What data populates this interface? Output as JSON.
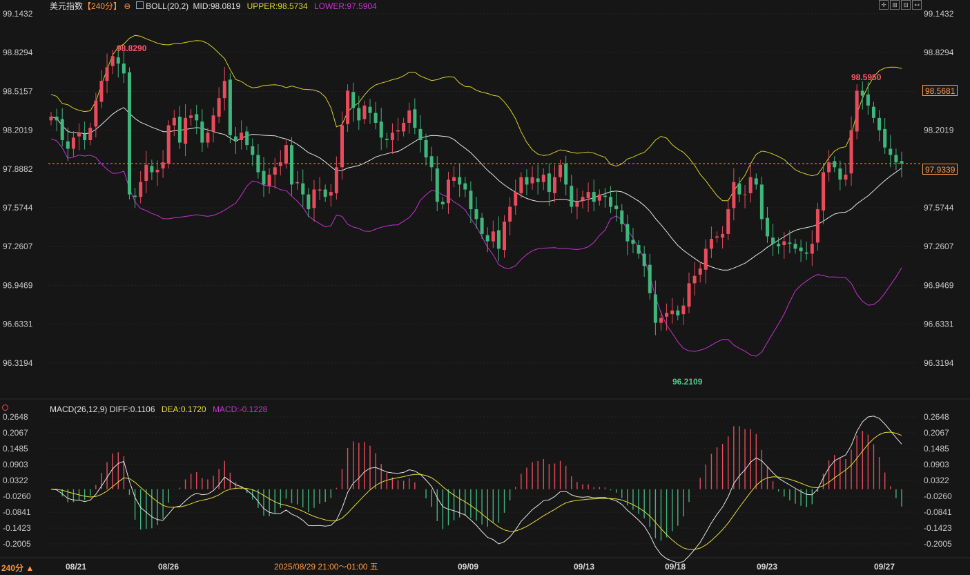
{
  "header": {
    "symbol": "美元指数",
    "period": "【240分】",
    "boll_label": "BOLL(20,2)",
    "mid_label": "MID:98.0819",
    "upper_label": "UPPER:98.5734",
    "lower_label": "LOWER:97.5904"
  },
  "macd_header": {
    "params": "MACD(26,12,9)",
    "diff": "DIFF:0.1106",
    "dea": "DEA:0.1720",
    "macd": "MACD:-0.1228"
  },
  "y_axis_price": [
    "99.1432",
    "98.8294",
    "98.5157",
    "98.2019",
    "97.8882",
    "97.5744",
    "97.2607",
    "96.9469",
    "96.6331",
    "96.3194"
  ],
  "y_axis_macd": [
    "0.2648",
    "0.2067",
    "0.1485",
    "0.0903",
    "0.0322",
    "-0.0260",
    "-0.0841",
    "-0.1423",
    "-0.2005"
  ],
  "x_axis_labels": [
    "08/21",
    "08/26",
    "09/09",
    "09/13",
    "09/18",
    "09/23",
    "09/27"
  ],
  "cursor_time": "2025/08/29 21:00～01:00 五",
  "period_button": "240分 ▲",
  "annotations": {
    "high1": "98.8290",
    "high2": "98.5950",
    "low1": "96.2109"
  },
  "price_tags": {
    "upper_tag": "98.5681",
    "current_tag": "97.9339"
  },
  "colors": {
    "bull": "#e84b5c",
    "bear": "#3fb67c",
    "upper": "#d8d22a",
    "lower": "#c832d2",
    "mid": "#e6e6e6",
    "dea": "#e6df3a"
  },
  "chart_data": {
    "type": "candlestick",
    "price_range": [
      96.2109,
      99.1432
    ],
    "closes": [
      98.31,
      98.28,
      98.12,
      98.05,
      98.14,
      98.18,
      98.12,
      98.22,
      98.44,
      98.6,
      98.71,
      98.8,
      98.74,
      98.66,
      97.68,
      97.66,
      97.78,
      97.92,
      97.86,
      97.88,
      97.94,
      98.24,
      98.3,
      98.1,
      98.3,
      98.32,
      98.28,
      98.1,
      98.18,
      98.32,
      98.46,
      98.6,
      98.16,
      98.12,
      98.18,
      98.08,
      98.0,
      97.86,
      97.76,
      97.84,
      97.9,
      97.94,
      98.08,
      97.76,
      97.78,
      97.68,
      97.56,
      97.72,
      97.72,
      97.66,
      97.7,
      97.9,
      98.24,
      98.52,
      98.38,
      98.28,
      98.4,
      98.34,
      98.26,
      98.14,
      98.12,
      98.18,
      98.2,
      98.26,
      98.36,
      98.22,
      98.12,
      97.98,
      97.9,
      97.62,
      97.6,
      97.8,
      97.82,
      97.76,
      97.72,
      97.56,
      97.48,
      97.36,
      97.3,
      97.38,
      97.24,
      97.46,
      97.58,
      97.7,
      97.82,
      97.76,
      97.82,
      97.78,
      97.84,
      97.7,
      97.82,
      97.92,
      97.76,
      97.58,
      97.62,
      97.66,
      97.7,
      97.62,
      97.68,
      97.66,
      97.58,
      97.56,
      97.44,
      97.3,
      97.28,
      97.2,
      97.1,
      96.88,
      96.64,
      96.68,
      96.72,
      96.74,
      96.7,
      96.78,
      96.96,
      97.02,
      97.08,
      97.24,
      97.32,
      97.34,
      97.36,
      97.56,
      97.78,
      97.68,
      97.68,
      97.82,
      97.76,
      97.48,
      97.34,
      97.28,
      97.26,
      97.3,
      97.28,
      97.24,
      97.22,
      97.2,
      97.28,
      97.56,
      97.86,
      97.94,
      97.9,
      97.8,
      97.84,
      98.2,
      98.52,
      98.48,
      98.4,
      98.3,
      98.2,
      98.06,
      98.0,
      97.94,
      97.93
    ]
  }
}
